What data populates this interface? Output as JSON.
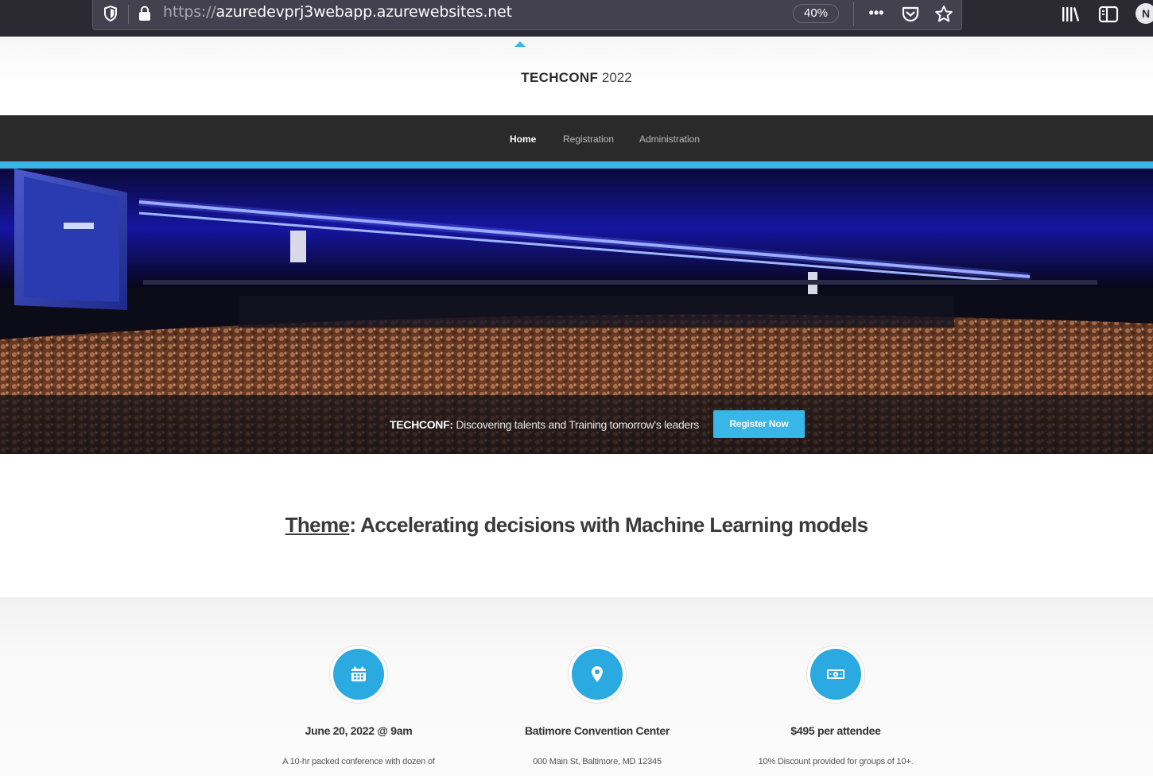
{
  "browser": {
    "url_protocol": "https://",
    "url_host": "azuredevprj3webapp.azurewebsites.net",
    "zoom": "40%",
    "more_label": "•••",
    "avatar_initial": "N"
  },
  "site": {
    "title_brand": "TECHCONF",
    "title_year": "2022"
  },
  "nav": {
    "items": [
      {
        "label": "Home",
        "active": true
      },
      {
        "label": "Registration",
        "active": false
      },
      {
        "label": "Administration",
        "active": false
      }
    ]
  },
  "hero": {
    "cta_brand": "TECHCONF:",
    "cta_text": " Discovering talents and Training tomorrow's leaders",
    "cta_button": "Register Now"
  },
  "theme": {
    "label": "Theme",
    "text": ": Accelerating decisions with Machine Learning models"
  },
  "features": [
    {
      "icon": "calendar-icon",
      "title": "June 20, 2022 @ 9am",
      "description": "A 10-hr packed conference with dozen of"
    },
    {
      "icon": "map-pin-icon",
      "title": "Batimore Convention Center",
      "description": "000 Main St, Baltimore, MD 12345"
    },
    {
      "icon": "money-icon",
      "title": "$495 per attendee",
      "description": "10% Discount provided for groups of 10+."
    }
  ],
  "colors": {
    "accent": "#38b6e8",
    "nav_bg": "#2a2a2a",
    "browser_bg": "#2b2a33"
  }
}
